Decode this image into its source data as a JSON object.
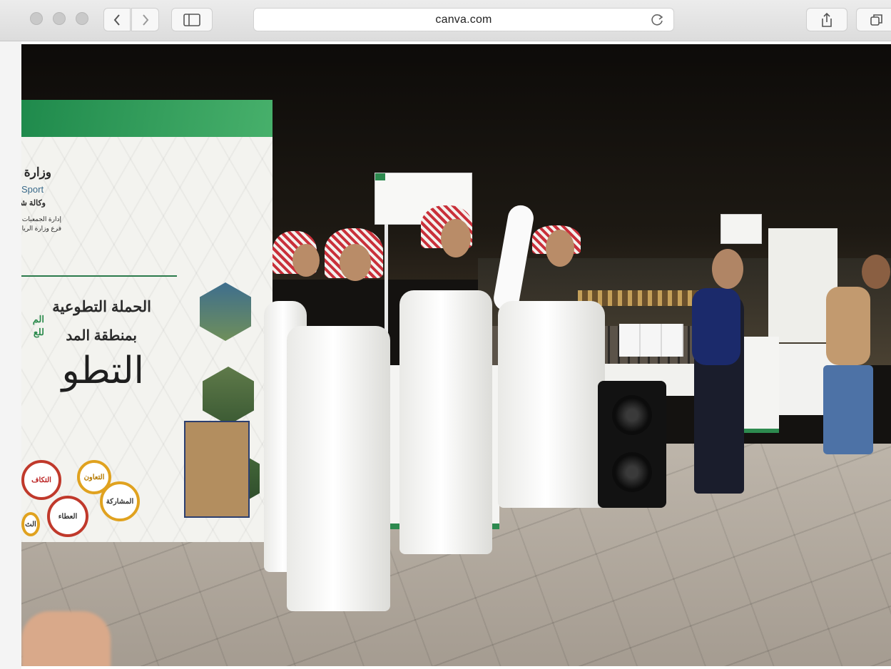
{
  "browser": {
    "url": "canva.com",
    "nav": {
      "back_icon": "chevron-left-icon",
      "forward_icon": "chevron-right-icon",
      "sidebar_icon": "sidebar-icon",
      "reload_icon": "reload-icon",
      "share_icon": "share-icon",
      "tabs_icon": "tabs-icon"
    }
  },
  "photo": {
    "banner": {
      "ministry": "وزارة",
      "sport": "Sport",
      "agency": "وكالة شوؤ",
      "dept_line1": "إدارة الجمعيات والمؤسسات",
      "dept_line2": "فرع وزارة الرياضة بم",
      "logo_line1": "الم",
      "logo_line2": "للع",
      "campaign": "الحملة التطوعية",
      "region": "بمنطقة المد",
      "big_word": "التطو",
      "bubbles": [
        "التكاف",
        "التعاون",
        "المشاركة",
        "العطاء",
        "الث"
      ]
    }
  }
}
